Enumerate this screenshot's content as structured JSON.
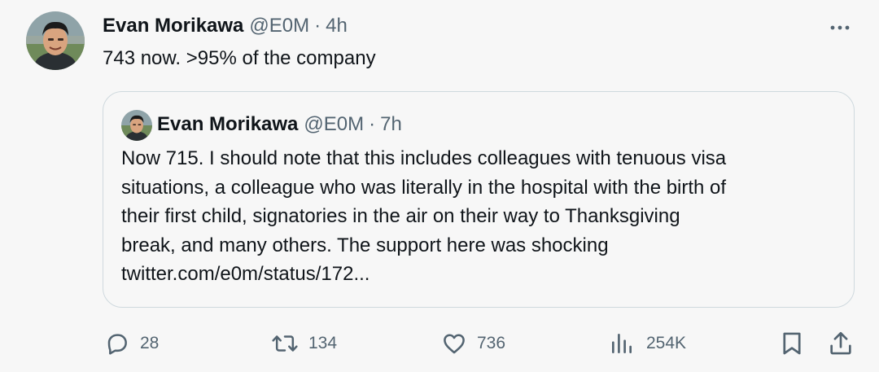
{
  "tweet": {
    "author_name": "Evan Morikawa",
    "author_handle": "@E0M",
    "separator": "·",
    "time": "4h",
    "text": "743 now. >95% of the company"
  },
  "quoted_tweet": {
    "author_name": "Evan Morikawa",
    "author_handle": "@E0M",
    "separator": "·",
    "time": "7h",
    "text_lines": [
      "Now 715. I should note that this includes colleagues with tenuous visa",
      "situations, a colleague who was literally in the hospital with the birth of",
      "their first child, signatories in the air on their way to Thanksgiving",
      "break, and many others. The support here was shocking",
      "twitter.com/e0m/status/172..."
    ]
  },
  "actions": {
    "replies": "28",
    "retweets": "134",
    "likes": "736",
    "views": "254K"
  },
  "icons": {
    "more": "more-dots-icon",
    "reply": "reply-bubble-icon",
    "retweet": "retweet-icon",
    "like": "heart-icon",
    "views": "views-bar-chart-icon",
    "bookmark": "bookmark-icon",
    "share": "share-upload-icon"
  },
  "colors": {
    "background": "#f7f7f7",
    "text_primary": "#0f1419",
    "text_secondary": "#536471",
    "border": "#cfd9de"
  }
}
